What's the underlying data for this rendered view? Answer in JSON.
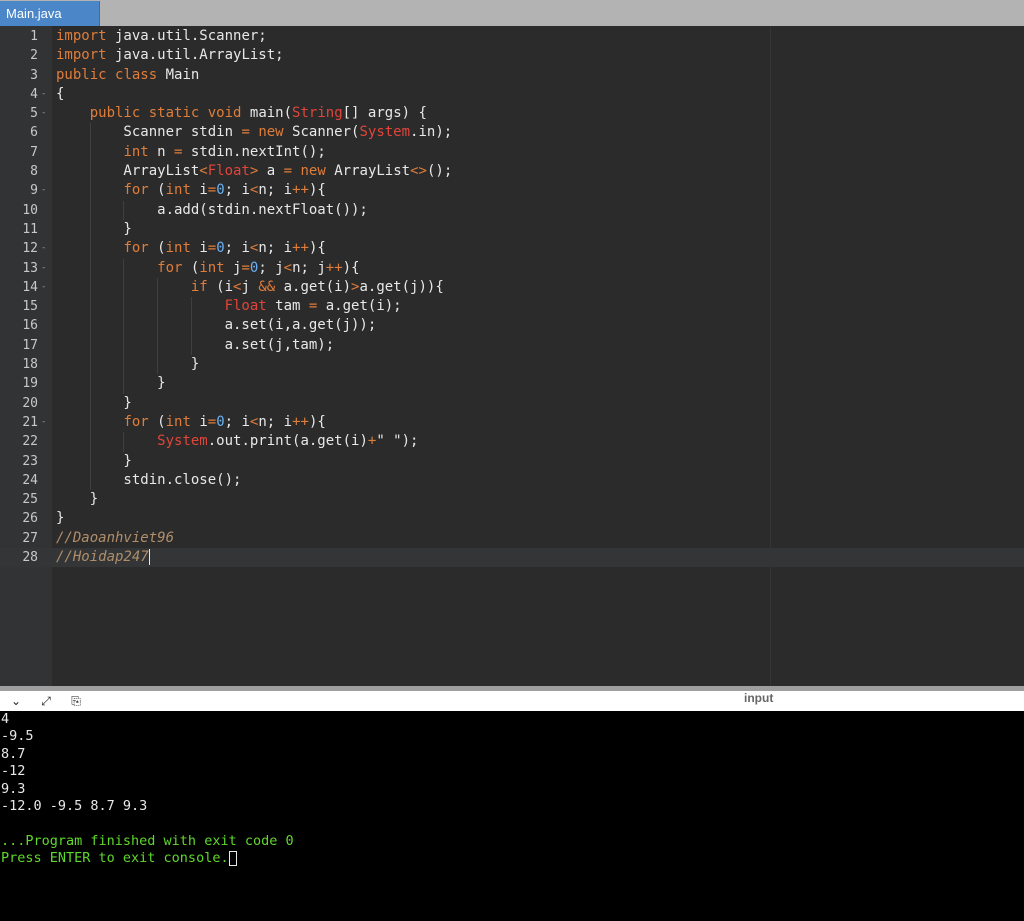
{
  "tab": {
    "title": "Main.java"
  },
  "editor": {
    "lines": [
      {
        "n": "1",
        "fold": false
      },
      {
        "n": "2",
        "fold": false
      },
      {
        "n": "3",
        "fold": false
      },
      {
        "n": "4",
        "fold": true
      },
      {
        "n": "5",
        "fold": true
      },
      {
        "n": "6",
        "fold": false
      },
      {
        "n": "7",
        "fold": false
      },
      {
        "n": "8",
        "fold": false
      },
      {
        "n": "9",
        "fold": true
      },
      {
        "n": "10",
        "fold": false
      },
      {
        "n": "11",
        "fold": false
      },
      {
        "n": "12",
        "fold": true
      },
      {
        "n": "13",
        "fold": true
      },
      {
        "n": "14",
        "fold": true
      },
      {
        "n": "15",
        "fold": false
      },
      {
        "n": "16",
        "fold": false
      },
      {
        "n": "17",
        "fold": false
      },
      {
        "n": "18",
        "fold": false
      },
      {
        "n": "19",
        "fold": false
      },
      {
        "n": "20",
        "fold": false
      },
      {
        "n": "21",
        "fold": true
      },
      {
        "n": "22",
        "fold": false
      },
      {
        "n": "23",
        "fold": false
      },
      {
        "n": "24",
        "fold": false
      },
      {
        "n": "25",
        "fold": false
      },
      {
        "n": "26",
        "fold": false
      },
      {
        "n": "27",
        "fold": false
      },
      {
        "n": "28",
        "fold": false
      }
    ],
    "code": [
      "import java.util.Scanner;",
      "import java.util.ArrayList;",
      "public class Main",
      "{",
      "    public static void main(String[] args) {",
      "        Scanner stdin = new Scanner(System.in);",
      "        int n = stdin.nextInt();",
      "        ArrayList<Float> a = new ArrayList<>();",
      "        for (int i=0; i<n; i++){",
      "            a.add(stdin.nextFloat());",
      "        }",
      "        for (int i=0; i<n; i++){",
      "            for (int j=0; j<n; j++){",
      "                if (i<j && a.get(i)>a.get(j)){",
      "                    Float tam = a.get(i);",
      "                    a.set(i,a.get(j));",
      "                    a.set(j,tam);",
      "                }",
      "            }",
      "        }",
      "        for (int i=0; i<n; i++){",
      "            System.out.print(a.get(i)+\" \");",
      "        }",
      "        stdin.close();",
      "    }",
      "}",
      "//Daoanhviet96",
      "//Hoidap247"
    ],
    "fold_marker": "-"
  },
  "console_toolbar": {
    "collapse_icon": "⌄",
    "expand_icon": "⤢",
    "copy_icon": "⎘",
    "input_label": "input"
  },
  "console": {
    "lines": [
      {
        "text": "4",
        "style": "normal"
      },
      {
        "text": "-9.5",
        "style": "normal"
      },
      {
        "text": "8.7",
        "style": "normal"
      },
      {
        "text": "-12",
        "style": "normal"
      },
      {
        "text": "9.3",
        "style": "normal"
      },
      {
        "text": "-12.0 -9.5 8.7 9.3",
        "style": "normal"
      },
      {
        "text": "",
        "style": "normal"
      },
      {
        "text": "...Program finished with exit code 0",
        "style": "green"
      },
      {
        "text": "Press ENTER to exit console.",
        "style": "green"
      }
    ]
  },
  "colors": {
    "keyword": "#e07d3a",
    "class": "#e0453a",
    "number": "#6ab0f3",
    "comment": "#b08e6a",
    "console_green": "#5fd82c",
    "tab_blue": "#4a86c8"
  }
}
